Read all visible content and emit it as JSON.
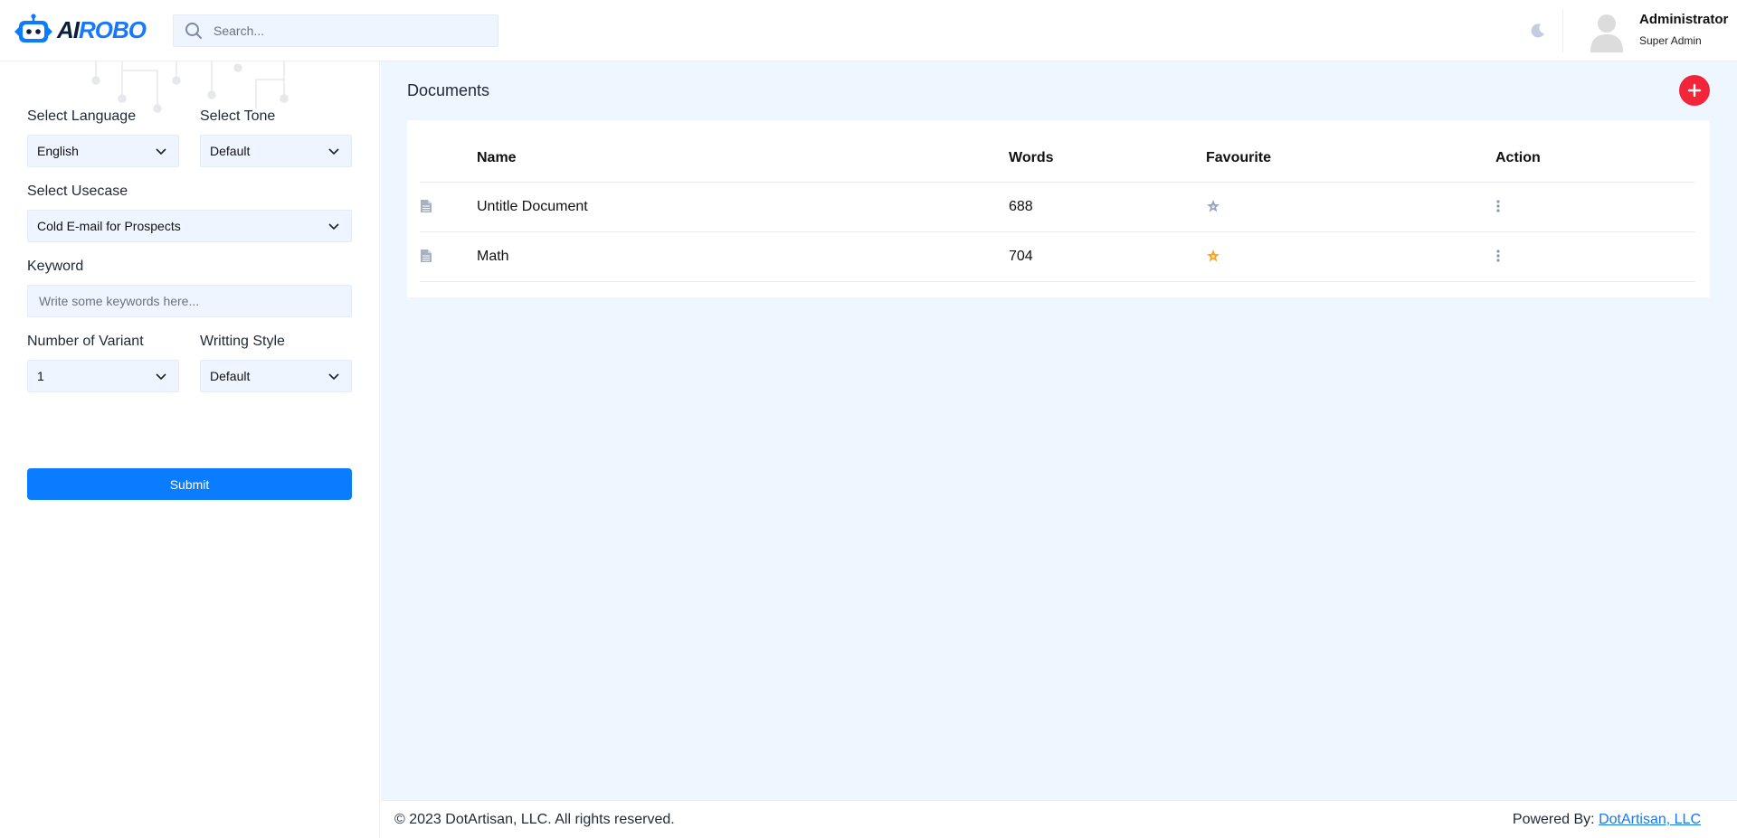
{
  "brand": {
    "ai": "AI",
    "robo": "ROBO"
  },
  "search": {
    "placeholder": "Search..."
  },
  "user": {
    "name": "Administrator",
    "role": "Super Admin"
  },
  "form": {
    "language": {
      "label": "Select Language",
      "value": "English"
    },
    "tone": {
      "label": "Select Tone",
      "value": "Default"
    },
    "usecase": {
      "label": "Select Usecase",
      "value": "Cold E-mail for Prospects"
    },
    "keyword": {
      "label": "Keyword",
      "placeholder": "Write some keywords here..."
    },
    "variant": {
      "label": "Number of Variant",
      "value": "1"
    },
    "style": {
      "label": "Writting Style",
      "value": "Default"
    },
    "submit_label": "Submit"
  },
  "documents": {
    "title": "Documents",
    "columns": {
      "name": "Name",
      "words": "Words",
      "favourite": "Favourite",
      "action": "Action"
    },
    "rows": [
      {
        "name": "Untitle Document",
        "words": "688",
        "favourite": false
      },
      {
        "name": "Math",
        "words": "704",
        "favourite": true
      }
    ]
  },
  "footer": {
    "copyright": "© 2023 DotArtisan, LLC. All rights reserved.",
    "powered_by": "Powered By:",
    "company": "DotArtisan, LLC"
  },
  "colors": {
    "accent": "#0a7cff",
    "add_button": "#f2263a",
    "favourite_on": "#f5a623",
    "favourite_off": "#9aa4c0",
    "panel_bg": "#eef6ff"
  },
  "icons": {
    "search": "search-icon",
    "theme": "moon-icon",
    "avatar": "user-avatar-icon",
    "add": "plus-icon",
    "document": "document-icon",
    "favourite": "star-icon",
    "action": "more-vertical-icon",
    "dropdown": "chevron-down-icon"
  }
}
